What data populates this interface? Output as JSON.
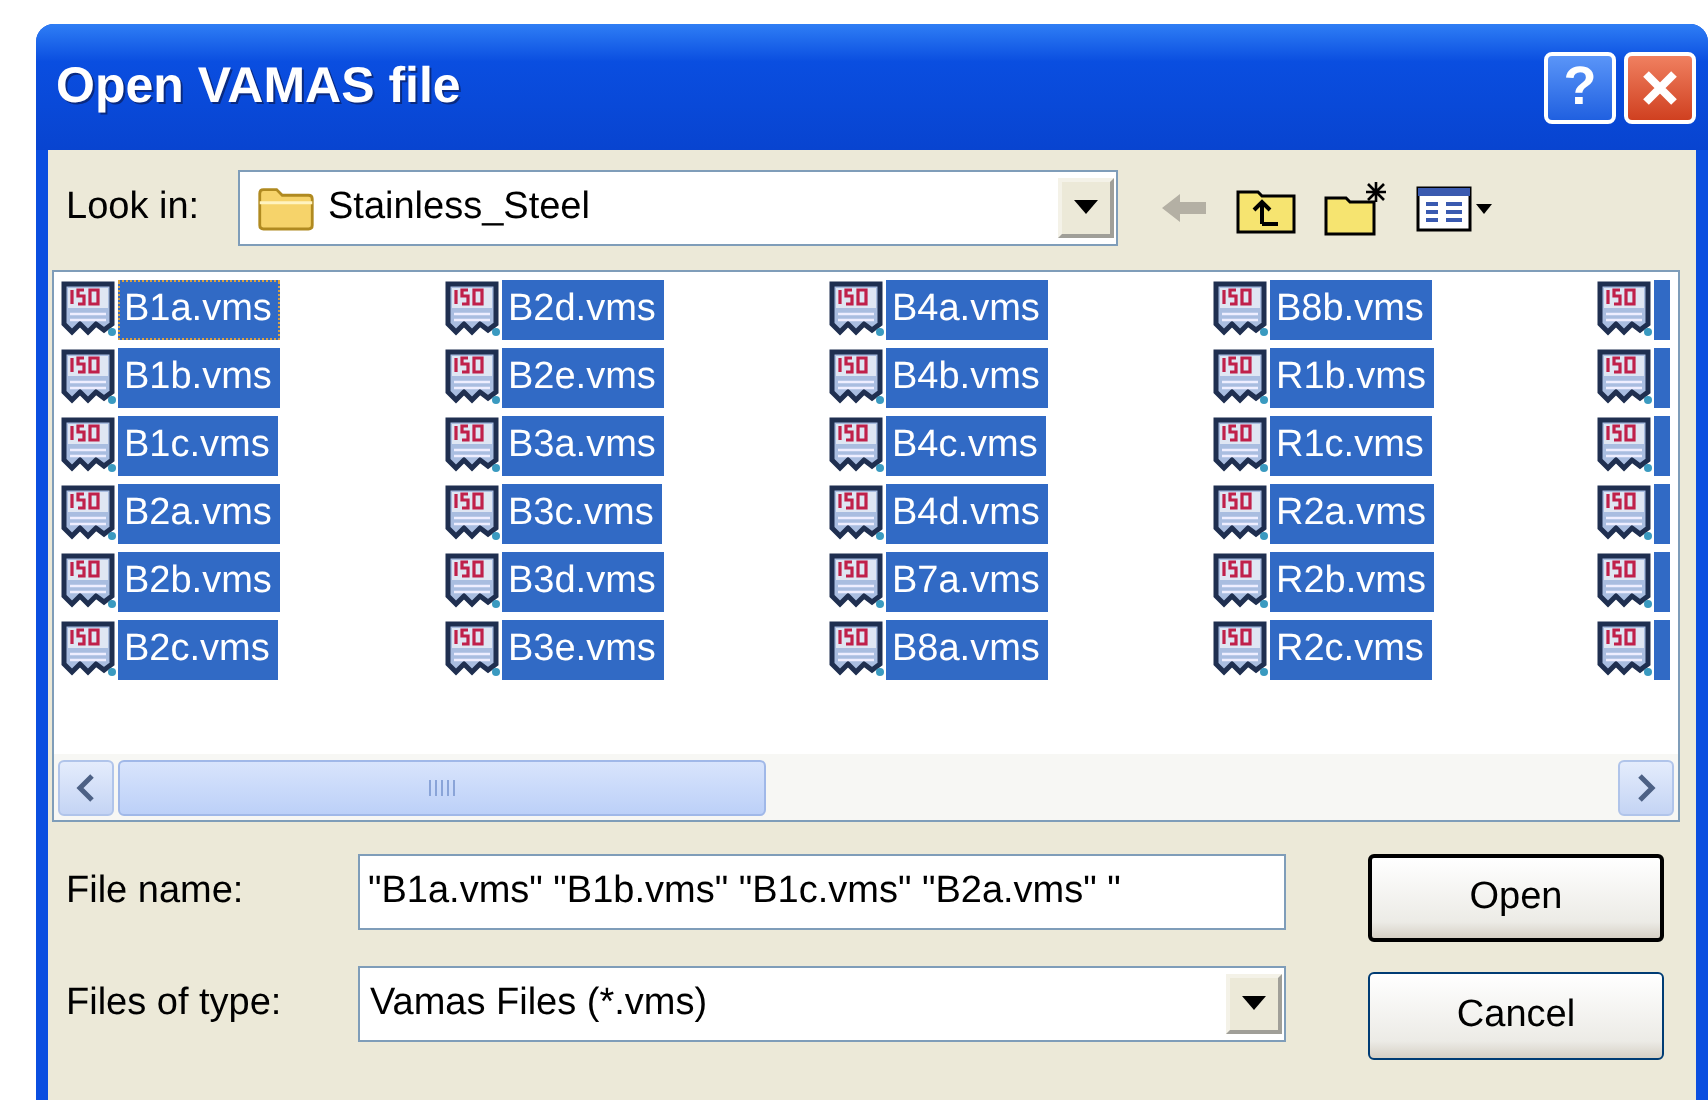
{
  "window": {
    "title": "Open VAMAS file",
    "help_button": "?"
  },
  "look_in": {
    "label": "Look in:",
    "value": "Stainless_Steel"
  },
  "toolbar": [
    {
      "kind": "back",
      "disabled": true
    },
    {
      "kind": "up"
    },
    {
      "kind": "new_folder"
    },
    {
      "kind": "views"
    }
  ],
  "files": [
    [
      {
        "name": "B1a.vms",
        "selected": true,
        "focused": true
      },
      {
        "name": "B1b.vms",
        "selected": true,
        "focused": false
      },
      {
        "name": "B1c.vms",
        "selected": true,
        "focused": false
      },
      {
        "name": "B2a.vms",
        "selected": true,
        "focused": false
      },
      {
        "name": "B2b.vms",
        "selected": true,
        "focused": false
      },
      {
        "name": "B2c.vms",
        "selected": true,
        "focused": false
      }
    ],
    [
      {
        "name": "B2d.vms",
        "selected": true,
        "focused": false
      },
      {
        "name": "B2e.vms",
        "selected": true,
        "focused": false
      },
      {
        "name": "B3a.vms",
        "selected": true,
        "focused": false
      },
      {
        "name": "B3c.vms",
        "selected": true,
        "focused": false
      },
      {
        "name": "B3d.vms",
        "selected": true,
        "focused": false
      },
      {
        "name": "B3e.vms",
        "selected": true,
        "focused": false
      }
    ],
    [
      {
        "name": "B4a.vms",
        "selected": true,
        "focused": false
      },
      {
        "name": "B4b.vms",
        "selected": true,
        "focused": false
      },
      {
        "name": "B4c.vms",
        "selected": true,
        "focused": false
      },
      {
        "name": "B4d.vms",
        "selected": true,
        "focused": false
      },
      {
        "name": "B7a.vms",
        "selected": true,
        "focused": false
      },
      {
        "name": "B8a.vms",
        "selected": true,
        "focused": false
      }
    ],
    [
      {
        "name": "B8b.vms",
        "selected": true,
        "focused": false
      },
      {
        "name": "R1b.vms",
        "selected": true,
        "focused": false
      },
      {
        "name": "R1c.vms",
        "selected": true,
        "focused": false
      },
      {
        "name": "R2a.vms",
        "selected": true,
        "focused": false
      },
      {
        "name": "R2b.vms",
        "selected": true,
        "focused": false
      },
      {
        "name": "R2c.vms",
        "selected": true,
        "focused": false
      }
    ],
    [
      {
        "selected": true
      },
      {
        "selected": true
      },
      {
        "selected": true
      },
      {
        "selected": true
      },
      {
        "selected": true
      },
      {
        "selected": true
      }
    ]
  ],
  "file_name": {
    "label": "File name:",
    "value": "\"B1a.vms\" \"B1b.vms\" \"B1c.vms\" \"B2a.vms\" \""
  },
  "file_type": {
    "label": "Files of type:",
    "value": "Vamas Files (*.vms)"
  },
  "buttons": [
    {
      "label": "Open",
      "default": true
    },
    {
      "label": "Cancel",
      "default": false
    }
  ]
}
